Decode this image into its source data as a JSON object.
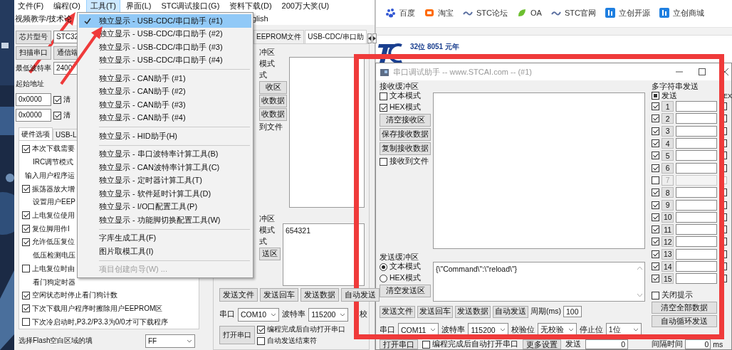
{
  "browser": {
    "bookmarks": [
      {
        "label": "百度",
        "kind": "paw"
      },
      {
        "label": "淘宝",
        "kind": "bag"
      },
      {
        "label": "STC论坛",
        "kind": "wave"
      },
      {
        "label": "OA",
        "kind": "leaf"
      },
      {
        "label": "STC官网",
        "kind": "wave"
      },
      {
        "label": "立创开源",
        "kind": "tile"
      },
      {
        "label": "立创商城",
        "kind": "tile"
      }
    ],
    "logo_caption": "32位 8051 元年"
  },
  "main_window": {
    "menu_bar": [
      {
        "label": "文件(F)",
        "selected": false
      },
      {
        "label": "编程(O)",
        "selected": false
      },
      {
        "label": "工具(T)",
        "selected": true
      },
      {
        "label": "界面(L)",
        "selected": false
      },
      {
        "label": "STC调试接口(G)",
        "selected": false
      },
      {
        "label": "资料下载(D)",
        "selected": false
      },
      {
        "label": "200万大奖(U)",
        "selected": false
      }
    ],
    "toolbar": [
      "视频教学/技术论",
      "glish"
    ],
    "left_rows": [
      [
        {
          "kind": "button",
          "text": "芯片型号"
        },
        {
          "kind": "field",
          "value": "STC32"
        }
      ],
      [
        {
          "kind": "button",
          "text": "扫描串口"
        },
        {
          "kind": "button",
          "text": "通信端"
        }
      ],
      [
        {
          "kind": "label",
          "text": "最低波特率"
        },
        {
          "kind": "field",
          "value": "2400"
        }
      ],
      [
        {
          "kind": "label",
          "text": "起始地址"
        }
      ],
      [
        {
          "kind": "field",
          "value": "0x0000"
        },
        {
          "kind": "check",
          "checked": true,
          "text": "清"
        }
      ],
      [
        {
          "kind": "field",
          "value": "0x0000"
        },
        {
          "kind": "check",
          "checked": true,
          "text": "清"
        }
      ]
    ],
    "option_tabs": [
      {
        "label": "硬件选项",
        "selected": true
      },
      {
        "label": "USB-L",
        "selected": false
      }
    ],
    "options": [
      {
        "kind": "check",
        "checked": true,
        "text": "本次下载需要"
      },
      {
        "kind": "subtext",
        "text": "IRC调节模式"
      },
      {
        "kind": "text",
        "text": "输入用户程序运"
      },
      {
        "kind": "check",
        "checked": true,
        "text": "振荡器放大增"
      },
      {
        "kind": "subtext",
        "text": "设置用户EEP"
      },
      {
        "kind": "check",
        "checked": true,
        "text": "上电复位使用"
      },
      {
        "kind": "check",
        "checked": true,
        "text": "复位脚用作I"
      },
      {
        "kind": "check",
        "checked": true,
        "text": "允许低压复位"
      },
      {
        "kind": "subtext",
        "text": "低压检测电压"
      },
      {
        "kind": "check",
        "checked": false,
        "text": "上电复位时由"
      },
      {
        "kind": "subtext",
        "text": "看门狗定时器"
      },
      {
        "kind": "check",
        "checked": true,
        "text": "空闲状态时停止看门狗计数"
      },
      {
        "kind": "check",
        "checked": true,
        "text": "下次下载用户程序时擦除用户EEPROM区"
      },
      {
        "kind": "check",
        "checked": false,
        "text": "下次冷启动时,P3.2/P3.3为0/0才可下载程序"
      }
    ],
    "fill_row": [
      {
        "kind": "label",
        "text": "选择Flash空白区域的填"
      },
      {
        "kind": "select",
        "value": "FF"
      }
    ],
    "panel_tabs": [
      {
        "label": "EEPROM文件",
        "selected": false
      },
      {
        "label": "USB-CDC/串口助",
        "selected": true
      }
    ],
    "receive_fragments": [
      {
        "kind": "label",
        "text": "冲区"
      },
      {
        "kind": "label",
        "text": "模式"
      },
      {
        "kind": "label",
        "text": "式"
      },
      {
        "kind": "button",
        "text": "收区"
      },
      {
        "kind": "button",
        "text": "收数据"
      },
      {
        "kind": "button",
        "text": "收数据"
      },
      {
        "kind": "label",
        "text": "到文件"
      }
    ],
    "send_fragments": [
      {
        "kind": "label",
        "text": "冲区"
      },
      {
        "kind": "label",
        "text": "模式"
      },
      {
        "kind": "label",
        "text": "式"
      },
      {
        "kind": "button",
        "text": "送区"
      }
    ],
    "send_text": "654321",
    "send_buttons": [
      {
        "kind": "button",
        "text": "发送文件"
      },
      {
        "kind": "button",
        "text": "发送回车"
      },
      {
        "kind": "button",
        "text": "发送数据"
      },
      {
        "kind": "button",
        "text": "自动发送"
      }
    ],
    "port_row": [
      {
        "kind": "label",
        "text": "串口"
      },
      {
        "kind": "select",
        "value": "COM10"
      },
      {
        "kind": "label",
        "text": "波特率"
      },
      {
        "kind": "select",
        "value": "115200"
      },
      {
        "kind": "label",
        "text": "校"
      }
    ],
    "open_button": "打开串口",
    "open_checks": [
      {
        "kind": "check",
        "checked": true,
        "text": "编程完成后自动打开串口"
      },
      {
        "kind": "check",
        "checked": false,
        "text": "自动发送结束符"
      }
    ]
  },
  "tools_menu": [
    {
      "kind": "item",
      "text": "独立显示 - USB-CDC/串口助手 (#1)",
      "checked": true,
      "highlighted": true,
      "disabled": false
    },
    {
      "kind": "item",
      "text": "独立显示 - USB-CDC/串口助手 (#2)",
      "checked": false,
      "highlighted": false,
      "disabled": false
    },
    {
      "kind": "item",
      "text": "独立显示 - USB-CDC/串口助手 (#3)",
      "checked": false,
      "highlighted": false,
      "disabled": false
    },
    {
      "kind": "item",
      "text": "独立显示 - USB-CDC/串口助手 (#4)",
      "checked": false,
      "highlighted": false,
      "disabled": false
    },
    {
      "kind": "separator"
    },
    {
      "kind": "item",
      "text": "独立显示 - CAN助手 (#1)",
      "checked": false,
      "highlighted": false,
      "disabled": false
    },
    {
      "kind": "item",
      "text": "独立显示 - CAN助手 (#2)",
      "checked": false,
      "highlighted": false,
      "disabled": false
    },
    {
      "kind": "item",
      "text": "独立显示 - CAN助手 (#3)",
      "checked": false,
      "highlighted": false,
      "disabled": false
    },
    {
      "kind": "item",
      "text": "独立显示 - CAN助手 (#4)",
      "checked": false,
      "highlighted": false,
      "disabled": false
    },
    {
      "kind": "separator"
    },
    {
      "kind": "item",
      "text": "独立显示 - HID助手(H)",
      "checked": false,
      "highlighted": false,
      "disabled": false
    },
    {
      "kind": "separator"
    },
    {
      "kind": "item",
      "text": "独立显示 - 串口波特率计算工具(B)",
      "checked": false,
      "highlighted": false,
      "disabled": false
    },
    {
      "kind": "item",
      "text": "独立显示 - CAN波特率计算工具(C)",
      "checked": false,
      "highlighted": false,
      "disabled": false
    },
    {
      "kind": "item",
      "text": "独立显示 - 定时器计算工具(T)",
      "checked": false,
      "highlighted": false,
      "disabled": false
    },
    {
      "kind": "item",
      "text": "独立显示 - 软件延时计算工具(D)",
      "checked": false,
      "highlighted": false,
      "disabled": false
    },
    {
      "kind": "item",
      "text": "独立显示 - I/O口配置工具(P)",
      "checked": false,
      "highlighted": false,
      "disabled": false
    },
    {
      "kind": "item",
      "text": "独立显示 - 功能脚切换配置工具(W)",
      "checked": false,
      "highlighted": false,
      "disabled": false
    },
    {
      "kind": "separator"
    },
    {
      "kind": "item",
      "text": "字库生成工具(F)",
      "checked": false,
      "highlighted": false,
      "disabled": false
    },
    {
      "kind": "item",
      "text": "图片取模工具(I)",
      "checked": false,
      "highlighted": false,
      "disabled": false
    },
    {
      "kind": "separator"
    },
    {
      "kind": "item",
      "text": "项目创建向导(W) ...",
      "checked": false,
      "highlighted": false,
      "disabled": true
    }
  ],
  "serial_window": {
    "title": "串口调试助手 -- www.STCAI.com -- (#1)",
    "receive_title": "接收缓冲区",
    "receive_options": [
      {
        "kind": "check",
        "checked": false,
        "text": "文本模式"
      },
      {
        "kind": "check",
        "checked": true,
        "text": "HEX模式"
      },
      {
        "kind": "button",
        "text": "清空接收区"
      },
      {
        "kind": "button",
        "text": "保存接收数据"
      },
      {
        "kind": "button",
        "text": "复制接收数据"
      },
      {
        "kind": "check",
        "checked": false,
        "text": "接收到文件"
      }
    ],
    "send_title": "发送缓冲区",
    "send_options": [
      {
        "kind": "radio",
        "selected": true,
        "text": "文本模式"
      },
      {
        "kind": "radio",
        "selected": false,
        "text": "HEX模式"
      },
      {
        "kind": "button",
        "text": "清空发送区"
      }
    ],
    "send_text": "{\\\"Command\\\":\\\"reload\\\"}",
    "send_buttons": [
      {
        "kind": "button",
        "text": "发送文件"
      },
      {
        "kind": "button",
        "text": "发送回车"
      },
      {
        "kind": "button",
        "text": "发送数据"
      },
      {
        "kind": "button",
        "text": "自动发送"
      },
      {
        "kind": "label",
        "text": "周期(ms)"
      },
      {
        "kind": "field",
        "value": "100"
      }
    ],
    "port_row": [
      {
        "kind": "label",
        "text": "串口"
      },
      {
        "kind": "select",
        "value": "COM11"
      },
      {
        "kind": "label",
        "text": "波特率"
      },
      {
        "kind": "select",
        "value": "115200"
      },
      {
        "kind": "label",
        "text": "校验位"
      },
      {
        "kind": "select",
        "value": "无校验"
      },
      {
        "kind": "label",
        "text": "停止位"
      },
      {
        "kind": "select",
        "value": "1位"
      }
    ],
    "bottom_row": [
      {
        "kind": "button",
        "text": "打开串口"
      },
      {
        "kind": "check",
        "checked": false,
        "text": "编程完成后自动打开串口"
      },
      {
        "kind": "button",
        "text": "更多设置"
      },
      {
        "kind": "label",
        "text": "发送"
      },
      {
        "kind": "field",
        "value": "0"
      }
    ],
    "multi_title": "多字符串发送",
    "multi_header": {
      "label": "发送",
      "indeterminate": true,
      "hex_label": "EX"
    },
    "multi_rows": [
      {
        "number": "1",
        "checked": true,
        "disabled": false
      },
      {
        "number": "2",
        "checked": true,
        "disabled": false
      },
      {
        "number": "3",
        "checked": true,
        "disabled": false
      },
      {
        "number": "4",
        "checked": true,
        "disabled": false
      },
      {
        "number": "5",
        "checked": true,
        "disabled": false
      },
      {
        "number": "6",
        "checked": true,
        "disabled": false
      },
      {
        "number": "7",
        "checked": false,
        "disabled": true
      },
      {
        "number": "8",
        "checked": true,
        "disabled": false
      },
      {
        "number": "9",
        "checked": true,
        "disabled": false
      },
      {
        "number": "10",
        "checked": true,
        "disabled": false
      },
      {
        "number": "11",
        "checked": true,
        "disabled": false
      },
      {
        "number": "12",
        "checked": true,
        "disabled": false
      },
      {
        "number": "13",
        "checked": true,
        "disabled": false
      },
      {
        "number": "14",
        "checked": true,
        "disabled": false
      },
      {
        "number": "15",
        "checked": true,
        "disabled": false
      }
    ],
    "close_tips": {
      "kind": "check",
      "checked": false,
      "text": "关闭提示"
    },
    "side_buttons": [
      "清空全部数据",
      "自动循环发送"
    ],
    "interval": [
      {
        "kind": "label",
        "text": "间隔时间"
      },
      {
        "kind": "field",
        "value": "0"
      },
      {
        "kind": "label",
        "text": "ms"
      }
    ]
  }
}
